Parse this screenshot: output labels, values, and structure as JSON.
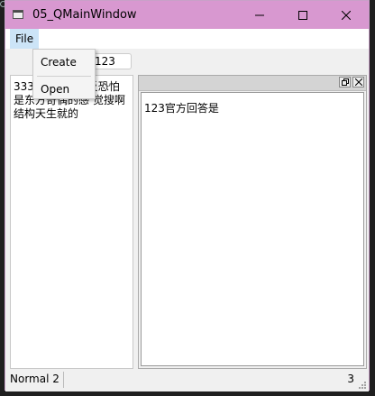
{
  "window": {
    "title": "05_QMainWindow"
  },
  "menubar": {
    "file_label": "File"
  },
  "file_menu": {
    "items": [
      "Create",
      "Open"
    ]
  },
  "toolbar": {
    "edit_value": "123"
  },
  "left_dock": {
    "text": "333第 23分迷 反恐怕是东方奇偶的感 觉搜啊结构天生就的"
  },
  "right_dock": {
    "text": "123官方回答是"
  },
  "statusbar": {
    "left_text": "Normal",
    "left_num": "2",
    "right_num": "3"
  },
  "colors": {
    "titlebar": "#d898d0",
    "menu_highlight": "#cce4f7"
  }
}
